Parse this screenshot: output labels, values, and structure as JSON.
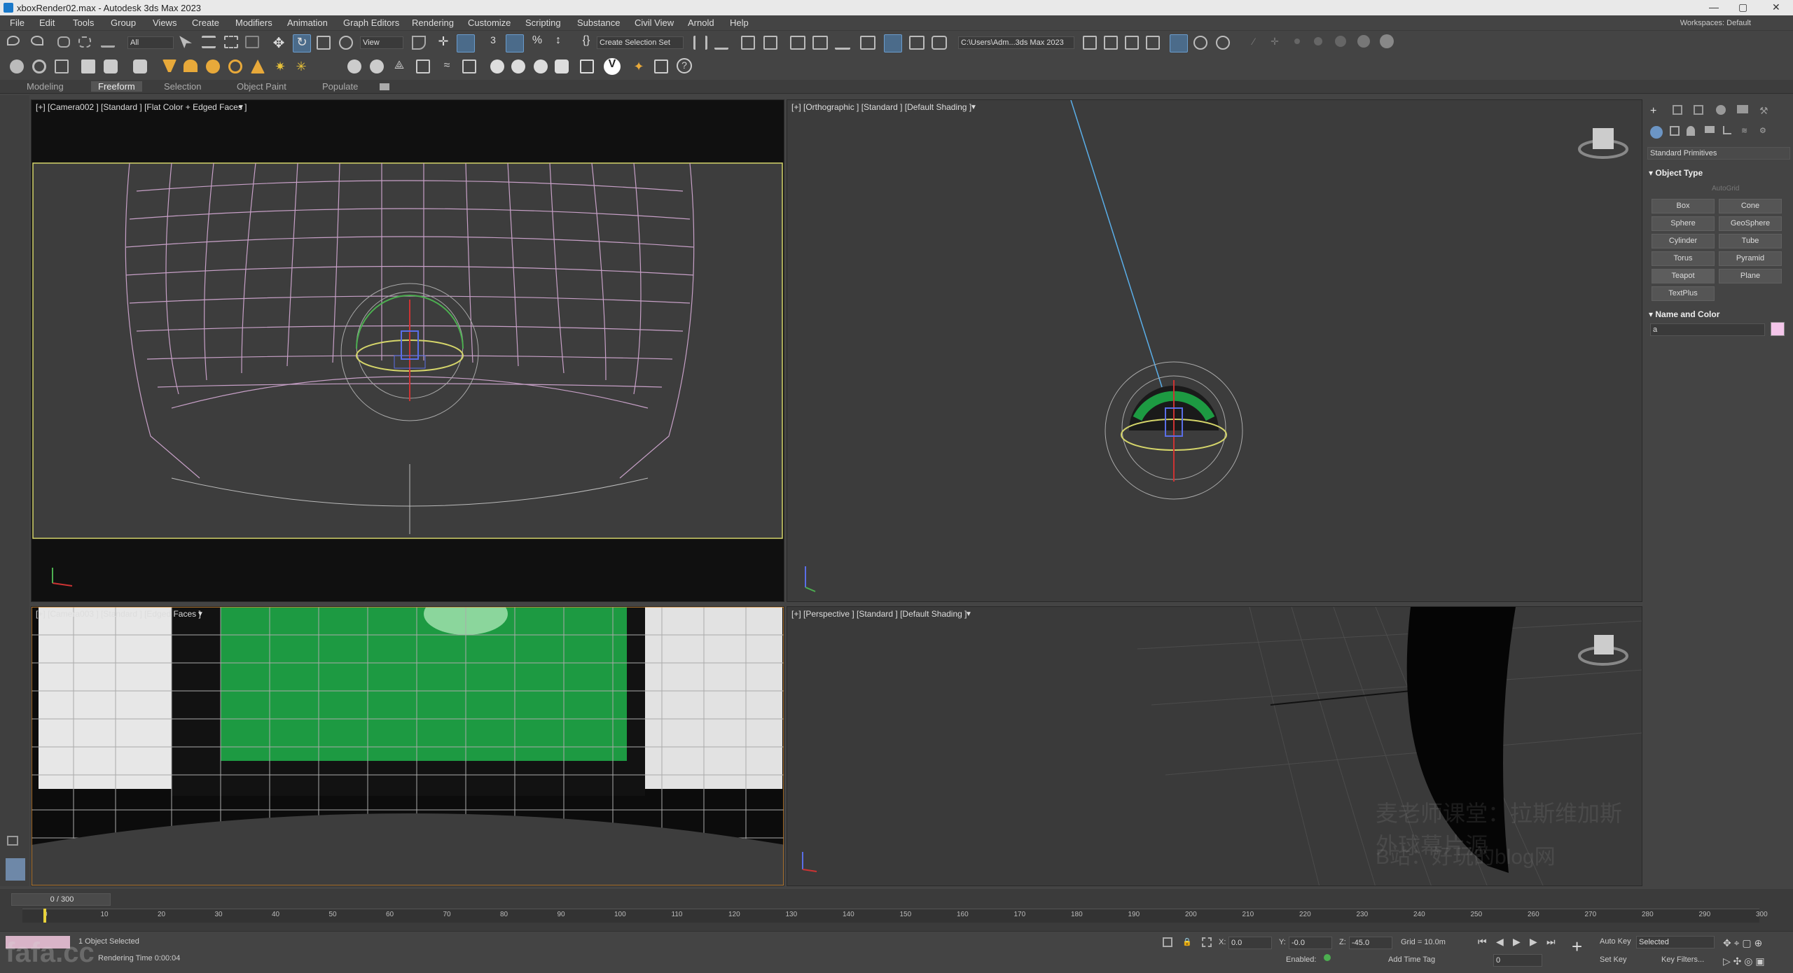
{
  "window": {
    "title": "xboxRender02.max - Autodesk 3ds Max 2023",
    "min": "—",
    "max": "▢",
    "close": "✕"
  },
  "menu": [
    "File",
    "Edit",
    "Tools",
    "Group",
    "Views",
    "Create",
    "Modifiers",
    "Animation",
    "Graph Editors",
    "Rendering",
    "Customize",
    "Scripting",
    "Substance",
    "Civil View",
    "Arnold",
    "Help"
  ],
  "workspaces": "Workspaces: Default",
  "toolbar": {
    "selection_filter": "All",
    "ref_coord": "View",
    "named_selection": "Create Selection Set",
    "project_path": "C:\\Users\\Adm...3ds Max 2023"
  },
  "ribbon": [
    "Modeling",
    "Freeform",
    "Selection",
    "Object Paint",
    "Populate"
  ],
  "viewports": {
    "top_left": "[+] [Camera002 ] [Standard ] [Flat Color + Edged Faces ]",
    "top_right": "[+] [Orthographic ] [Standard ] [Default Shading ]",
    "bottom_left": "[+] [Camera003 ] [Standard ] [Edged Faces ]",
    "bottom_right": "[+] [Perspective ] [Standard ] [Default Shading ]"
  },
  "command_panel": {
    "dropdown": "Standard Primitives",
    "object_type": "Object Type",
    "autogrid": "AutoGrid",
    "buttons": [
      "Box",
      "Cone",
      "Sphere",
      "GeoSphere",
      "Cylinder",
      "Tube",
      "Torus",
      "Pyramid",
      "Teapot",
      "Plane",
      "TextPlus"
    ],
    "name_and_color": "Name and Color",
    "name_value": "a"
  },
  "timeline": {
    "frame": "0 / 300",
    "ticks": [
      "0",
      "10",
      "20",
      "30",
      "40",
      "50",
      "60",
      "70",
      "80",
      "90",
      "100",
      "110",
      "120",
      "130",
      "140",
      "150",
      "160",
      "170",
      "180",
      "190",
      "200",
      "210",
      "220",
      "230",
      "240",
      "250",
      "260",
      "270",
      "280",
      "290",
      "300"
    ]
  },
  "status": {
    "selected": "1 Object Selected",
    "time": "Rendering Time 0:00:04",
    "x": "0.0",
    "y": "-0.0",
    "z": "-45.0",
    "x_label": "X:",
    "y_label": "Y:",
    "z_label": "Z:",
    "grid": "Grid = 10.0m",
    "auto_key": "Auto Key",
    "set_key": "Set Key",
    "selected_dd": "Selected",
    "key_filters": "Key Filters...",
    "enabled": "Enabled:",
    "add_time_tag": "Add Time Tag",
    "frame_field": "0"
  },
  "watermark": {
    "line1": "麦老师课堂：拉斯维加斯外球幕片源",
    "line2": "B站：好玩的blog网",
    "logo": "fafa.cc"
  },
  "colors": {
    "green_screen": "#1d9a42",
    "selection": "#d5d56a",
    "wire": "#c7a0c7",
    "object_color": "#f4c6ea"
  }
}
